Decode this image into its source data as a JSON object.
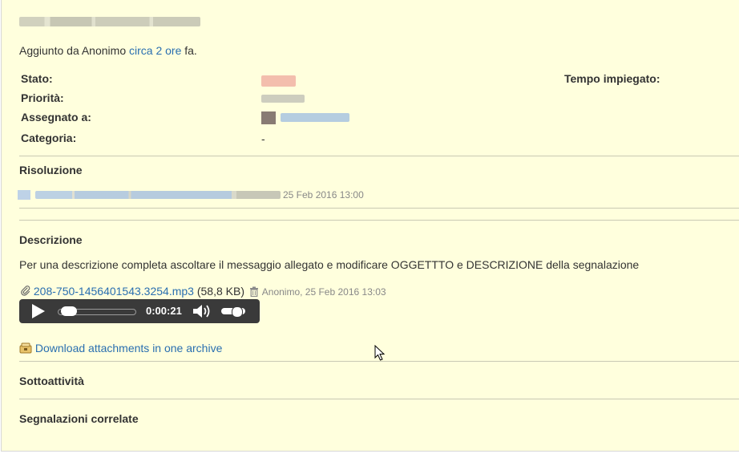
{
  "issue": {
    "added_prefix": "Aggiunto da Anonimo ",
    "added_link": "circa 2 ore",
    "added_suffix": " fa.",
    "attributes": {
      "stato_label": "Stato:",
      "priorita_label": "Priorità:",
      "assegnato_label": "Assegnato a:",
      "categoria_label": "Categoria:",
      "categoria_value": "-",
      "tempo_label": "Tempo impiegato:"
    },
    "resolution": {
      "title": "Risoluzione",
      "date": "25 Feb 2016 13:00"
    },
    "description": {
      "title": "Descrizione",
      "text": "Per una descrizione completa ascoltare il messaggio allegato e modificare OGGETTTO e DESCRIZIONE della segnalazione"
    },
    "attachment": {
      "filename": "208-750-1456401543.3254.mp3",
      "size": "(58,8 KB)",
      "author_date": "Anonimo, 25 Feb 2016 13:03"
    },
    "player": {
      "time": "0:00:21",
      "progress": 0.05,
      "volume": 0.7
    },
    "download_label": "Download attachments in one archive",
    "subtasks_title": "Sottoattività",
    "related_title": "Segnalazioni correlate"
  },
  "colors": {
    "background": "#ffffdd",
    "link": "#2a6fb0",
    "player": "#3a3a3a"
  },
  "icons": [
    "paperclip-icon",
    "trash-icon",
    "play-icon",
    "volume-icon",
    "archive-icon",
    "mouse-cursor-icon"
  ]
}
